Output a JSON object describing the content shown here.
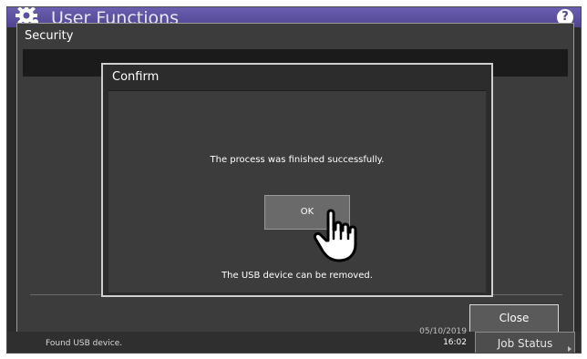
{
  "app": {
    "title": "User Functions",
    "help_label": "?",
    "icon": "gear-icon"
  },
  "security": {
    "title": "Security",
    "close_label": "Close"
  },
  "confirm": {
    "title": "Confirm",
    "message": "The process was finished successfully.",
    "ok_label": "OK",
    "note": "The USB device can be removed."
  },
  "status": {
    "message": "Found USB device.",
    "date": "05/10/2019",
    "time": "16:02",
    "job_status_label": "Job Status"
  },
  "colors": {
    "titlebar": "#5a4fa0",
    "panel": "#3c3c3c",
    "dark_bar": "#1b1b1b",
    "text": "#ffffff"
  },
  "icons": [
    "gear-icon",
    "help-icon",
    "hand-pointer-icon"
  ]
}
